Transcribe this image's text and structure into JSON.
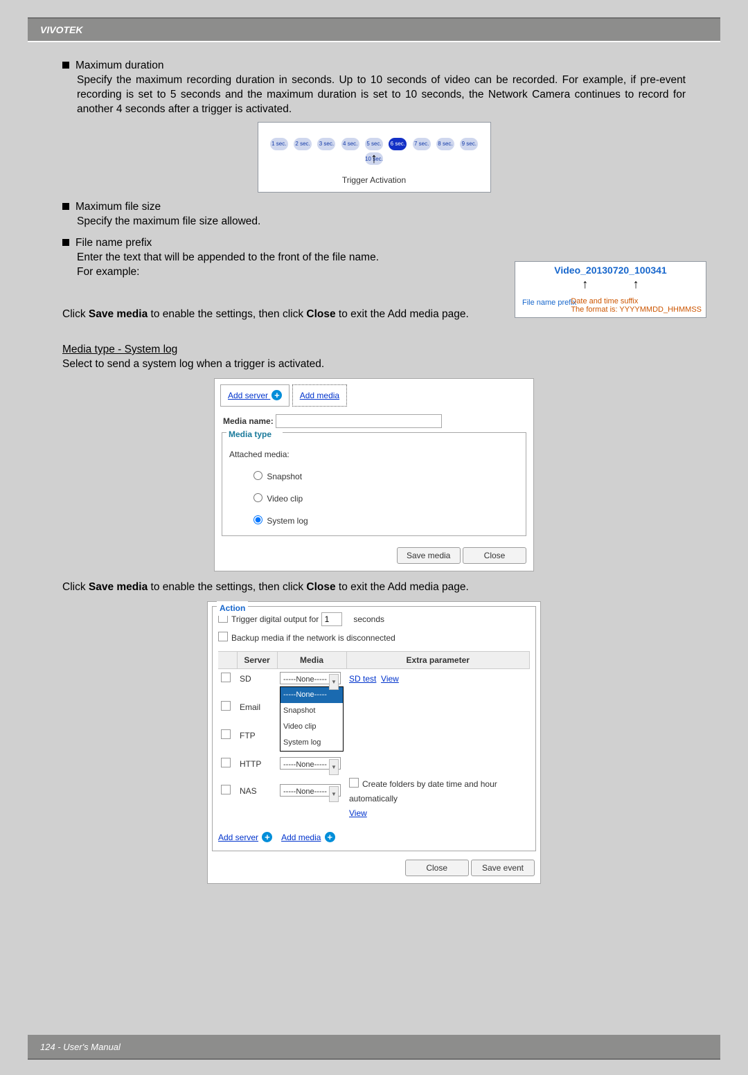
{
  "header": {
    "brand": "VIVOTEK"
  },
  "bullets": {
    "max_duration": {
      "title": "Maximum duration",
      "desc": "Specify the maximum recording duration in seconds. Up to 10 seconds of video can be recorded. For example, if pre-event recording is set to 5 seconds and the maximum duration is set to 10 seconds, the Network Camera continues to record for another 4 seconds after a trigger is activated."
    },
    "max_file_size": {
      "title": "Maximum file size",
      "desc": "Specify the maximum file size allowed."
    },
    "file_prefix": {
      "title": "File name prefix",
      "desc1": "Enter the text that will be appended to the front of the file name.",
      "desc2": "For example:"
    }
  },
  "trigger_diagram": {
    "labels": [
      "1 sec.",
      "2 sec.",
      "3 sec.",
      "4 sec.",
      "5 sec.",
      "6 sec.",
      "7 sec.",
      "8 sec.",
      "9 sec.",
      "10 sec."
    ],
    "caption": "Trigger Activation"
  },
  "fname_box": {
    "title": "Video_20130720_100341",
    "left": "File name prefix",
    "right_l1": "Date and time suffix",
    "right_l2": "The format is: YYYYMMDD_HHMMSS"
  },
  "line_after_prefix_pre": "Click ",
  "line_after_prefix_savemedia": "Save media",
  "line_after_prefix_mid": " to enable the settings, then click ",
  "line_after_prefix_close": "Close",
  "line_after_prefix_end": " to exit the Add media page.",
  "media_heading": "Media type - System log",
  "media_heading_desc": "Select to send a system log when a trigger is activated.",
  "media_dialog": {
    "tabs": {
      "add_server": "Add server",
      "add_media": "Add media"
    },
    "media_name_label": "Media name:",
    "media_type_legend": "Media type",
    "attached_media": "Attached media:",
    "options": {
      "snapshot": "Snapshot",
      "videoclip": "Video clip",
      "systemlog": "System log"
    },
    "save": "Save media",
    "close": "Close"
  },
  "line_save2_pre": "Click ",
  "line_save2_savemedia": "Save media",
  "line_save2_mid": " to enable the settings, then click ",
  "line_save2_close": "Close",
  "line_save2_end": " to exit the Add media page.",
  "action_dialog": {
    "legend": "Action",
    "trigger_do": "Trigger digital output for",
    "trigger_do_val": "1",
    "trigger_do_unit": "seconds",
    "backup": "Backup media if the network is disconnected",
    "table": {
      "head_server": "Server",
      "head_media": "Media",
      "head_extra": "Extra parameter",
      "rows": {
        "sd": "SD",
        "email": "Email",
        "ftp": "FTP",
        "http": "HTTP",
        "nas": "NAS"
      },
      "none_option": "-----None-----",
      "dd": [
        "-----None-----",
        "Snapshot",
        "Video clip",
        "System log"
      ],
      "sd_test": "SD test",
      "view": "View",
      "nas_folders": "Create folders by date time and hour automatically"
    },
    "add_server": "Add server",
    "add_media": "Add media",
    "close": "Close",
    "save_event": "Save event"
  },
  "footer": "124 - User's Manual"
}
